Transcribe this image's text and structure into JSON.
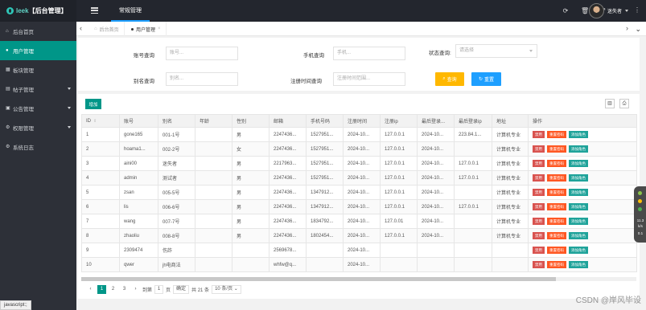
{
  "header": {
    "logo_prefix": "leek",
    "logo_title": "【后台管理】",
    "nav_item": "常规管理",
    "user_name": "迷失者"
  },
  "sidebar": {
    "items": [
      {
        "label": "后台首页",
        "icon": "home-icon",
        "active": false,
        "has_arrow": false
      },
      {
        "label": "用户管理",
        "icon": "user-icon",
        "active": true,
        "has_arrow": false
      },
      {
        "label": "板块管理",
        "icon": "board-icon",
        "active": false,
        "has_arrow": false
      },
      {
        "label": "帖子管理",
        "icon": "post-icon",
        "active": false,
        "has_arrow": true
      },
      {
        "label": "公告管理",
        "icon": "notice-icon",
        "active": false,
        "has_arrow": true
      },
      {
        "label": "权限管理",
        "icon": "permission-icon",
        "active": false,
        "has_arrow": true
      },
      {
        "label": "系统日志",
        "icon": "log-icon",
        "active": false,
        "has_arrow": false
      }
    ],
    "status_tip": "javascript:;"
  },
  "tabs": {
    "home": "后台首页",
    "current": "用户管理"
  },
  "search": {
    "account_label": "账号查询",
    "account_placeholder": "账号...",
    "phone_label": "手机查询",
    "phone_placeholder": "手机...",
    "status_label": "状态查询:",
    "status_placeholder": "请选择",
    "alias_label": "别名查询",
    "alias_placeholder": "别名...",
    "time_label": "注册时间查询",
    "time_placeholder": "注册时间范围...",
    "search_button": "查询",
    "reset_button": "重置"
  },
  "toolbar": {
    "add_button": "增加"
  },
  "table": {
    "headers": [
      "ID",
      "账号",
      "别名",
      "年龄",
      "性别",
      "邮箱",
      "手机号码",
      "注册时间",
      "注册ip",
      "最后登录...",
      "最后登录ip",
      "地址",
      "操作"
    ],
    "rows": [
      [
        "1",
        "gone165",
        "001-1号",
        "",
        "男",
        "2247436...",
        "1527951...",
        "2024-10...",
        "127.0.0.1",
        "2024-10...",
        "223.84.1...",
        "计算机专业"
      ],
      [
        "2",
        "hoama1...",
        "002-2号",
        "",
        "女",
        "2247436...",
        "1527951...",
        "2024-10...",
        "127.0.0.1",
        "2024-10...",
        "",
        "计算机专业"
      ],
      [
        "3",
        "aini00",
        "迷失者",
        "",
        "男",
        "2217963...",
        "1527951...",
        "2024-10...",
        "127.0.0.1",
        "2024-10...",
        "127.0.0.1",
        "计算机专业"
      ],
      [
        "4",
        "admin",
        "测试者",
        "",
        "男",
        "2247436...",
        "1527951...",
        "2024-10...",
        "127.0.0.1",
        "2024-10...",
        "127.0.0.1",
        "计算机专业"
      ],
      [
        "5",
        "zsan",
        "005-5号",
        "",
        "男",
        "2247436...",
        "1347912...",
        "2024-10...",
        "127.0.0.1",
        "2024-10...",
        "",
        "计算机专业"
      ],
      [
        "6",
        "lis",
        "006-6号",
        "",
        "男",
        "2247436...",
        "1347912...",
        "2024-10...",
        "127.0.0.1",
        "2024-10...",
        "127.0.0.1",
        "计算机专业"
      ],
      [
        "7",
        "wang",
        "007-7号",
        "",
        "男",
        "2247436...",
        "1834792...",
        "2024-10...",
        "127.0.01",
        "2024-10...",
        "",
        "计算机专业"
      ],
      [
        "8",
        "zhaoliu",
        "008-8号",
        "",
        "男",
        "2247436...",
        "1802454...",
        "2024-10...",
        "127.0.0.1",
        "2024-10...",
        "",
        "计算机专业"
      ],
      [
        "9",
        "2309474",
        "伤詐",
        "",
        "",
        "2569678...",
        "",
        "2024-10...",
        "",
        "",
        "",
        ""
      ],
      [
        "10",
        "qwer",
        "jh电商法",
        "",
        "",
        "whfw@q...",
        "",
        "2024-10...",
        "",
        "",
        "",
        ""
      ]
    ],
    "op_disable": "禁用",
    "op_reset": "重置密码",
    "op_role": "添加角色"
  },
  "pager": {
    "pages": [
      "1",
      "2",
      "3"
    ],
    "current": "1",
    "next": "›",
    "goto_label": "到第",
    "goto_value": "1",
    "page_unit": "页",
    "confirm": "确定",
    "total": "共 21 条",
    "per_page": "10 条/页"
  },
  "widget": {
    "value": "11.3",
    "unit": "k/s",
    "value2": "0.1"
  },
  "watermark": "CSDN @岸风毕设"
}
